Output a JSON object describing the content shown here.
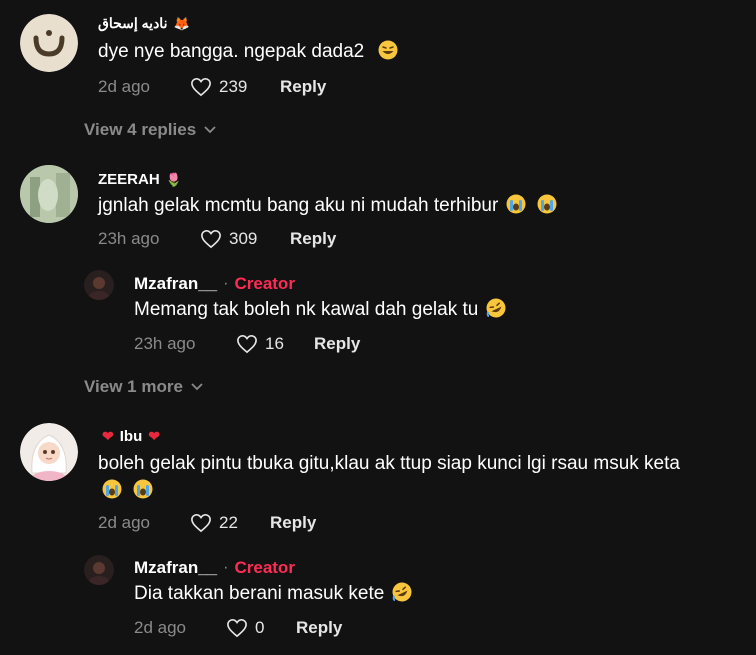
{
  "comments": [
    {
      "username": "نادیه إسحاق",
      "text": "dye nye bangga. ngepak dada2",
      "time": "2d ago",
      "likes": "239",
      "reply_label": "Reply",
      "view_more": "View 4 replies"
    },
    {
      "username": "ZEERAH",
      "text": "jgnlah gelak mcmtu bang aku ni mudah terhibur",
      "time": "23h ago",
      "likes": "309",
      "reply_label": "Reply",
      "reply": {
        "username": "Mzafran__",
        "badge": "Creator",
        "text": "Memang tak boleh nk kawal dah gelak tu",
        "time": "23h ago",
        "likes": "16",
        "reply_label": "Reply"
      },
      "view_more": "View 1 more"
    },
    {
      "username": "Ibu",
      "text_line1": "boleh gelak pintu tbuka gitu,klau ak ttup siap kunci lgi rsau msuk keta",
      "time": "2d ago",
      "likes": "22",
      "reply_label": "Reply",
      "reply": {
        "username": "Mzafran__",
        "badge": "Creator",
        "text": "Dia takkan berani masuk kete",
        "time": "2d ago",
        "likes": "0",
        "reply_label": "Reply"
      }
    }
  ],
  "colors": {
    "background": "#121212",
    "creator_badge": "#fe2c55",
    "muted": "#8a8a8a"
  }
}
